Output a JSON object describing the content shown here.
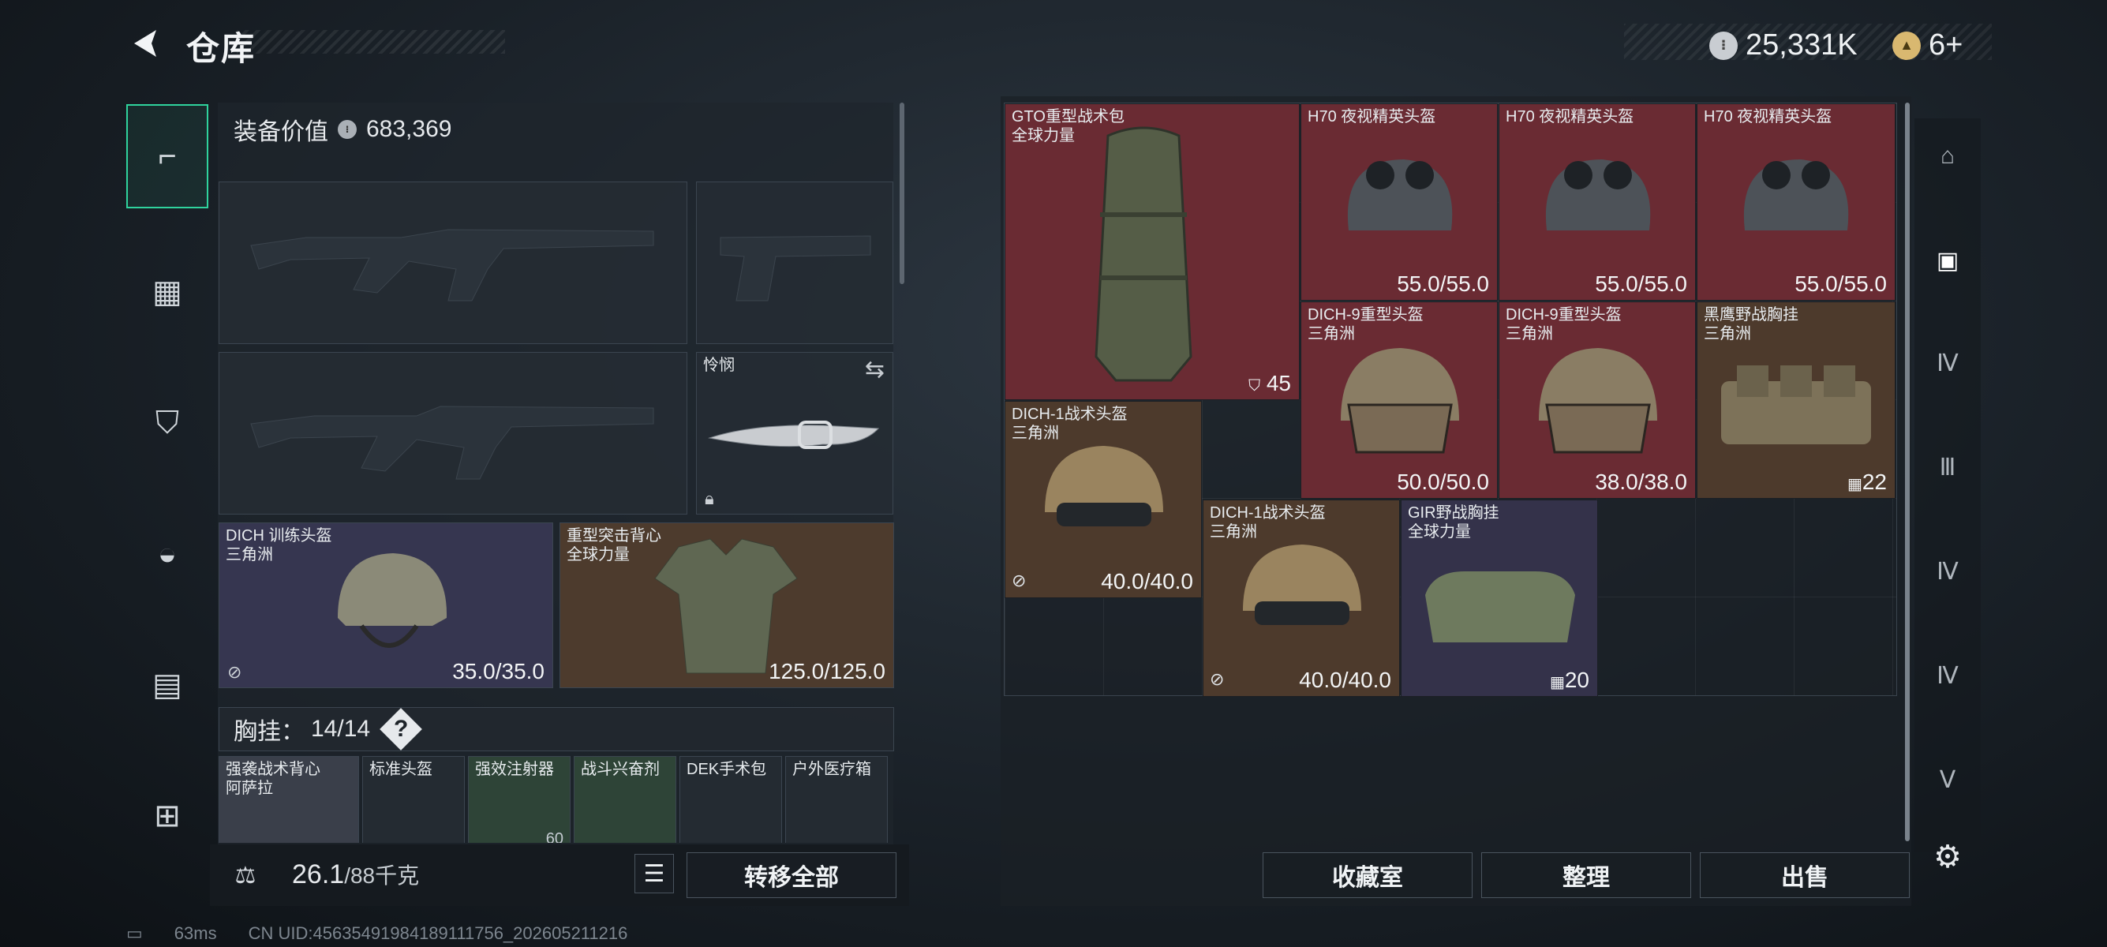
{
  "header": {
    "title": "仓库",
    "currency_1": "25,331K",
    "currency_2": "6+"
  },
  "equip": {
    "label": "装备价值",
    "value": "683,369"
  },
  "melee": {
    "label": "怜悯"
  },
  "helmet": {
    "name": "DICH 训练头盔",
    "sub": "三角洲",
    "durability": "35.0/35.0"
  },
  "armor": {
    "name": "重型突击背心",
    "sub": "全球力量",
    "durability": "125.0/125.0"
  },
  "rig": {
    "label": "胸挂：",
    "count": "14/14",
    "help": "?"
  },
  "rig_items": [
    {
      "name": "强袭战术背心",
      "sub": "阿萨拉"
    },
    {
      "name": "标准头盔",
      "sub": ""
    },
    {
      "name": "强效注射器",
      "sub": "",
      "count": "60"
    },
    {
      "name": "战斗兴奋剂",
      "sub": ""
    },
    {
      "name": "DEK手术包",
      "sub": ""
    },
    {
      "name": "户外医疗箱",
      "sub": ""
    }
  ],
  "weight": {
    "value": "26.1",
    "max": "/88千克"
  },
  "buttons": {
    "transfer_all": "转移全部",
    "collection": "收藏室",
    "organize": "整理",
    "sell": "出售"
  },
  "stash": [
    {
      "name": "GTO重型战术包",
      "sub": "全球力量",
      "stat": "45"
    },
    {
      "name": "H70 夜视精英头盔",
      "sub": "",
      "stat": "55.0/55.0"
    },
    {
      "name": "H70 夜视精英头盔",
      "sub": "",
      "stat": "55.0/55.0"
    },
    {
      "name": "H70 夜视精英头盔",
      "sub": "",
      "stat": "55.0/55.0"
    },
    {
      "name": "DICH-9重型头盔",
      "sub": "三角洲",
      "stat": "50.0/50.0"
    },
    {
      "name": "DICH-9重型头盔",
      "sub": "三角洲",
      "stat": "38.0/38.0"
    },
    {
      "name": "黑鹰野战胸挂",
      "sub": "三角洲",
      "stat": "22"
    },
    {
      "name": "DICH-1战术头盔",
      "sub": "三角洲",
      "stat": "40.0/40.0"
    },
    {
      "name": "DICH-1战术头盔",
      "sub": "三角洲",
      "stat": "40.0/40.0"
    },
    {
      "name": "GIR野战胸挂",
      "sub": "全球力量",
      "stat": "20"
    }
  ],
  "status": {
    "ping": "63ms",
    "uid": "CN UID:456354919841891117​56_202605211216"
  },
  "icons": [
    "back-arrow-icon",
    "silver-coin-icon",
    "gold-coin-icon",
    "pistol-icon",
    "vest-icon",
    "backpack-icon",
    "pouch-icon",
    "case-icon",
    "toolbox-icon",
    "swap-icon",
    "lock-icon",
    "weight-icon",
    "list-icon",
    "settings-icon"
  ]
}
